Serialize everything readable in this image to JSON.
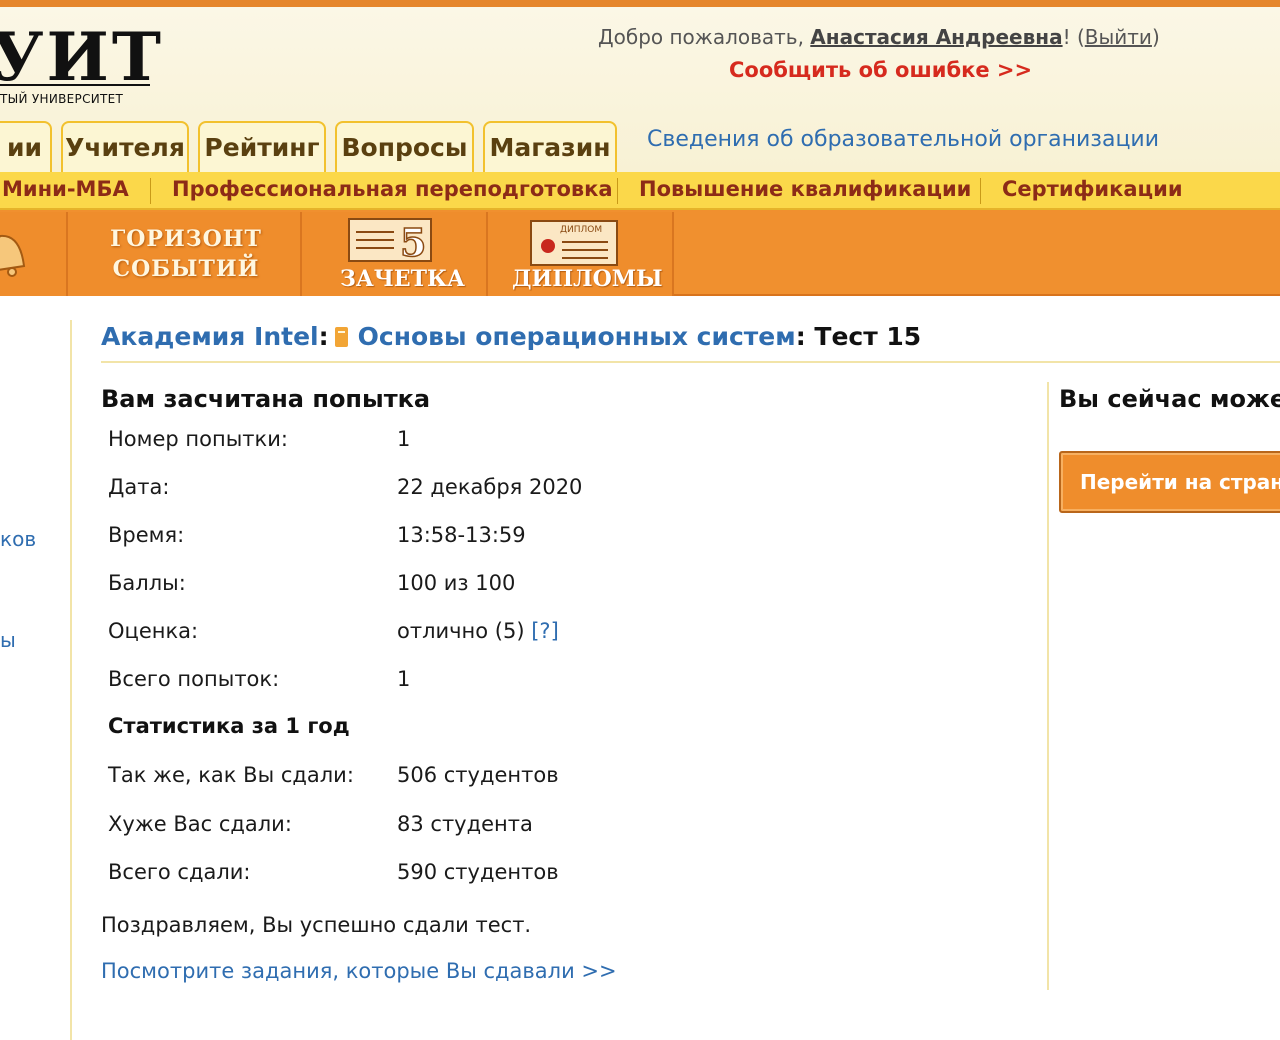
{
  "logo": {
    "title": "УИТ",
    "subtitle": "ТЫЙ УНИВЕРСИТЕТ"
  },
  "header": {
    "welcome_prefix": "Добро пожаловать, ",
    "user_name": "Анастасия Андреевна",
    "welcome_mid": "! (",
    "logout": "Выйти",
    "welcome_suffix": ")",
    "report_error": "Сообщить об ошибке >>"
  },
  "tabs": [
    "ии",
    "Учителя",
    "Рейтинг",
    "Вопросы",
    "Магазин"
  ],
  "edu_info_link": "Сведения об образовательной организации",
  "yellow_menu": [
    "Мини-МБА",
    "Профессиональная переподготовка",
    "Повышение квалификации",
    "Сертификации"
  ],
  "banner": {
    "horizon_line1": "ГОРИЗОНТ",
    "horizon_line2": "СОБЫТИЙ",
    "zachetka": "ЗАЧЕТКА",
    "zachetka_mark": "5",
    "diplomy": "ДИПЛОМЫ",
    "diploma_label": "ДИПЛОМ"
  },
  "left_fragments": [
    "ков",
    "ы"
  ],
  "breadcrumb": {
    "academy": "Академия Intel",
    "sep1": ":",
    "course": "Основы операционных систем",
    "sep2": ": ",
    "test": "Тест 15"
  },
  "result": {
    "title": "Вам засчитана попытка",
    "rows": [
      {
        "label": "Номер попытки:",
        "value": "1"
      },
      {
        "label": "Дата:",
        "value": "22 декабря 2020"
      },
      {
        "label": "Время:",
        "value": "13:58-13:59"
      },
      {
        "label": "Баллы:",
        "value": "100 из 100"
      },
      {
        "label": "Оценка:",
        "value": "отлично (5) ",
        "help": "[?]"
      },
      {
        "label": "Всего попыток:",
        "value": "1"
      }
    ],
    "stats_title": "Статистика за 1 год",
    "stats": [
      {
        "label": "Так же, как Вы сдали:",
        "value": "506 студентов"
      },
      {
        "label": "Хуже Вас сдали:",
        "value": "83 студента"
      },
      {
        "label": "Всего сдали:",
        "value": "590 студентов"
      }
    ],
    "congrats": "Поздравляем, Вы успешно сдали тест.",
    "view_tasks": "Посмотрите задания, которые Вы сдавали >>"
  },
  "sidebar_right": {
    "title": "Вы сейчас може",
    "button": "Перейти на стран"
  },
  "colors": {
    "accent_orange": "#ef8d2c",
    "link_blue": "#2f6db0",
    "report_red": "#d62a1e",
    "menu_yellow": "#fbd84a"
  }
}
